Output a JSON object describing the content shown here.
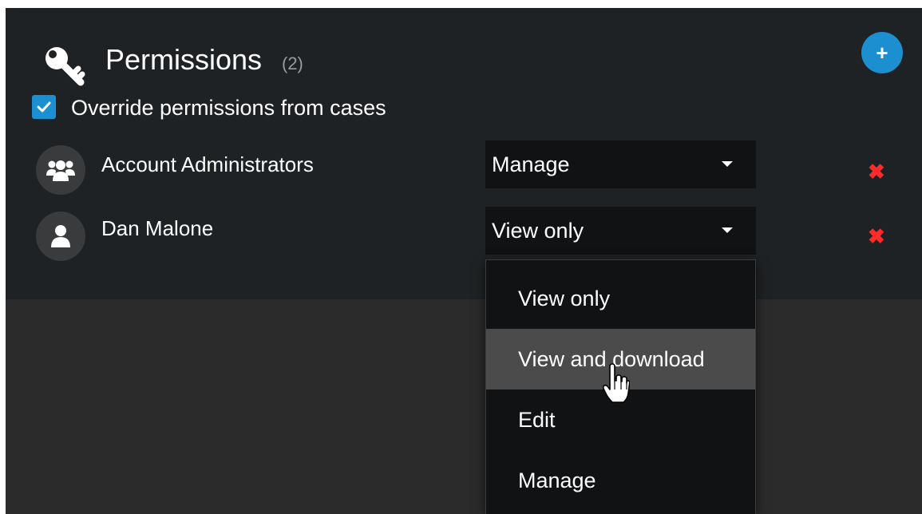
{
  "header": {
    "title": "Permissions",
    "count": "(2)",
    "icon": "key-icon",
    "add_button_icon": "plus-icon"
  },
  "override": {
    "checked": true,
    "label": "Override permissions from cases"
  },
  "entries": [
    {
      "name": "Account Administrators",
      "avatar_icon": "users-group-icon",
      "permission": "Manage",
      "remove_icon": "close-icon"
    },
    {
      "name": "Dan Malone",
      "avatar_icon": "user-icon",
      "permission": "View only",
      "remove_icon": "close-icon"
    }
  ],
  "dropdown": {
    "open": true,
    "options": [
      "View only",
      "View and download",
      "Edit",
      "Manage"
    ],
    "hovered": "View and download"
  },
  "colors": {
    "accent": "#1b8fd0",
    "remove": "#ff2a2a",
    "panel_bg": "#1f2224",
    "page_bg": "#2b2b2b"
  }
}
